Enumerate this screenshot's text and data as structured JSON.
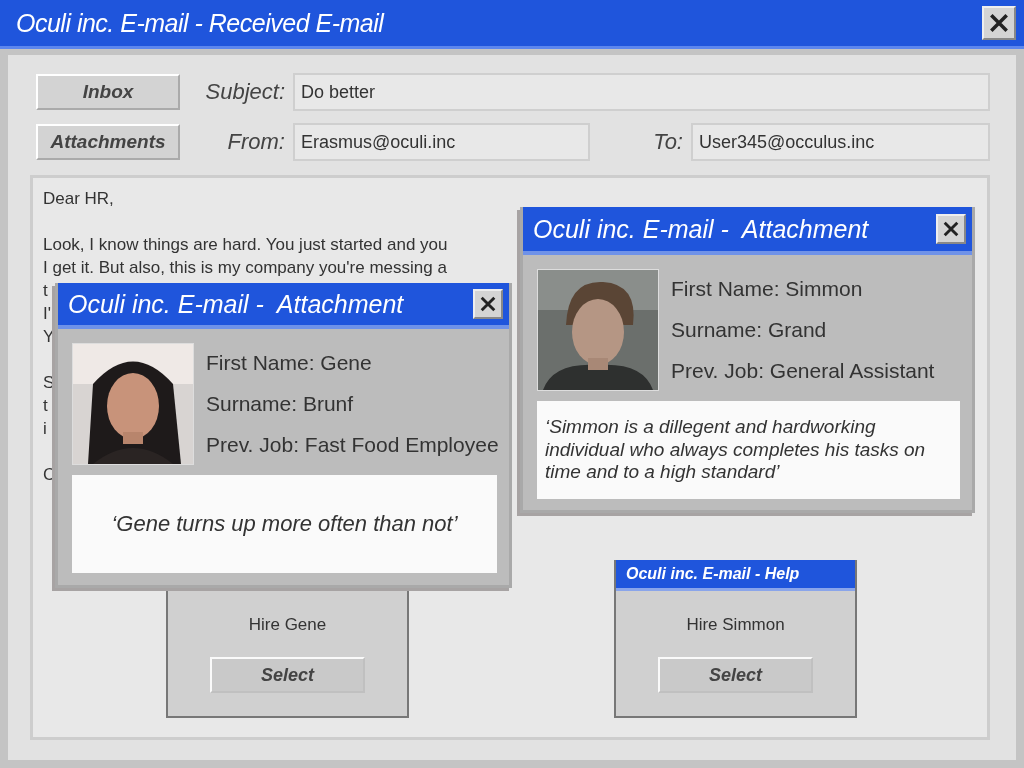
{
  "window": {
    "title": "Oculi inc. E-mail - Received E-mail"
  },
  "nav_buttons": [
    {
      "label": "Inbox"
    },
    {
      "label": "Attachments"
    }
  ],
  "fields": {
    "subject": {
      "label": "Subject:",
      "value": "Do better"
    },
    "from": {
      "label": "From:",
      "value": "Erasmus@oculi.inc"
    },
    "to": {
      "label": "To:",
      "value": "User345@occulus.inc"
    }
  },
  "body": {
    "paragraphs": [
      {
        "lines": [
          "Dear HR,"
        ]
      },
      {
        "lines": [
          "Look, I know things are hard. You just started and you",
          "I get it. But also, this is my company you're messing a",
          "t",
          "I'",
          "Y"
        ]
      },
      {
        "lines": [
          "S",
          "t",
          "i"
        ]
      },
      {
        "lines": [
          "C"
        ]
      }
    ]
  },
  "choices": [
    {
      "label": "Hire Gene",
      "button": "Select"
    },
    {
      "title": "Oculi inc. E-mail - Help",
      "label": "Hire Simmon",
      "button": "Select"
    }
  ],
  "attachments": [
    {
      "title": "Oculi inc. E-mail -  Attachment",
      "first_name": "First Name: Gene",
      "surname": "Surname: Brunf",
      "prev_job": "Prev. Job: Fast Food Employee",
      "quote": "‘Gene turns up more often than not’"
    },
    {
      "title": "Oculi inc. E-mail -  Attachment",
      "first_name": "First Name: Simmon",
      "surname": "Surname: Grand",
      "prev_job": "Prev. Job: General Assistant",
      "quote": "‘Simmon is a dillegent and hardworking individual who always completes his tasks on time and to a high standard’"
    }
  ]
}
